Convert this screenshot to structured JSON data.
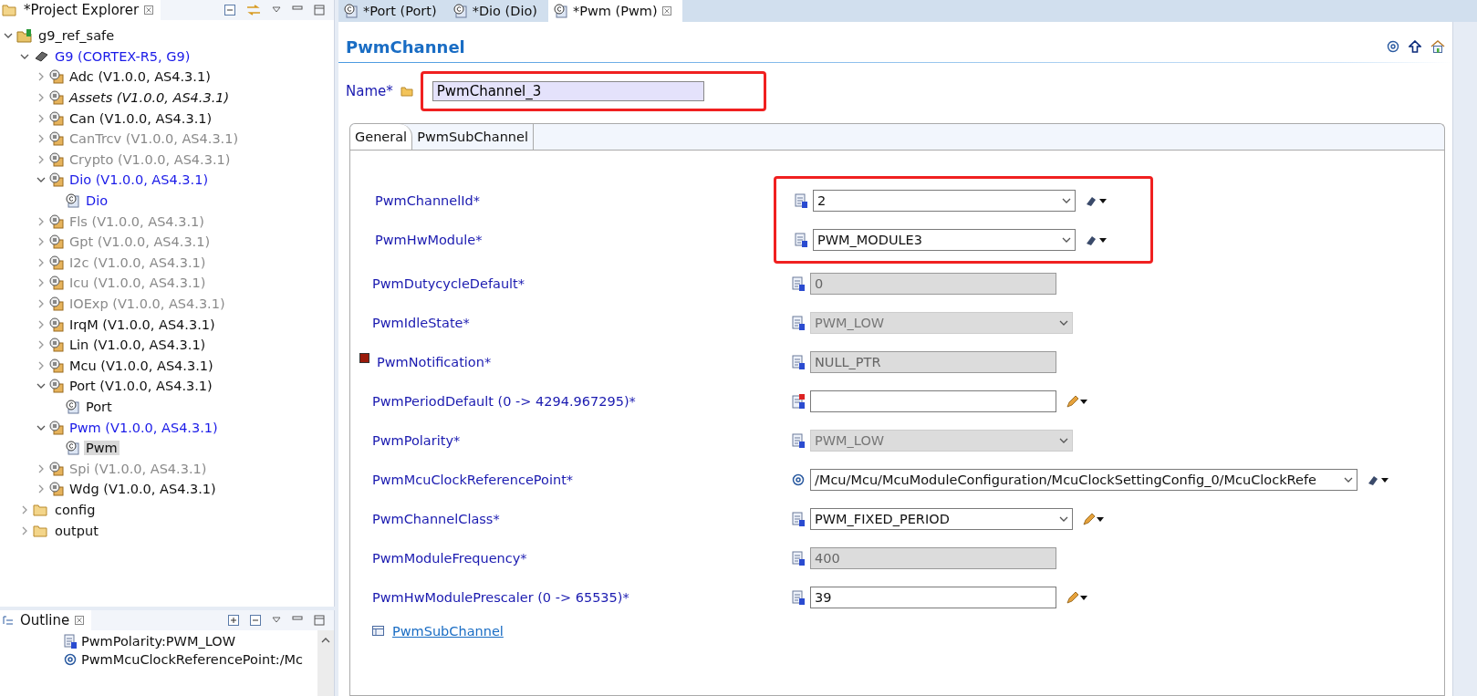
{
  "project_explorer": {
    "title": "*Project Explorer",
    "tree": [
      {
        "label": "g9_ref_safe",
        "kind": "project",
        "disabled": false,
        "modified": false,
        "emphasized": false,
        "expanded": true,
        "selected": false,
        "children": [
          {
            "label": "G9 (CORTEX-R5, G9)",
            "kind": "chip",
            "disabled": false,
            "modified": true,
            "emphasized": false,
            "expanded": true,
            "selected": false,
            "children": [
              {
                "label": "Adc (V1.0.0, AS4.3.1)",
                "kind": "module",
                "disabled": false,
                "modified": false,
                "emphasized": false,
                "expanded": false,
                "selected": false
              },
              {
                "label": "Assets (V1.0.0, AS4.3.1)",
                "kind": "module",
                "disabled": false,
                "modified": false,
                "emphasized": true,
                "expanded": false,
                "selected": false
              },
              {
                "label": "Can (V1.0.0, AS4.3.1)",
                "kind": "module",
                "disabled": false,
                "modified": false,
                "emphasized": false,
                "expanded": false,
                "selected": false
              },
              {
                "label": "CanTrcv (V1.0.0, AS4.3.1)",
                "kind": "module",
                "disabled": true,
                "modified": false,
                "emphasized": false,
                "expanded": false,
                "selected": false
              },
              {
                "label": "Crypto (V1.0.0, AS4.3.1)",
                "kind": "module",
                "disabled": true,
                "modified": false,
                "emphasized": false,
                "expanded": false,
                "selected": false
              },
              {
                "label": "Dio (V1.0.0, AS4.3.1)",
                "kind": "module",
                "disabled": false,
                "modified": true,
                "emphasized": false,
                "expanded": true,
                "selected": false,
                "children": [
                  {
                    "label": "Dio",
                    "kind": "config",
                    "disabled": false,
                    "modified": true,
                    "emphasized": false,
                    "selected": false
                  }
                ]
              },
              {
                "label": "Fls (V1.0.0, AS4.3.1)",
                "kind": "module",
                "disabled": true,
                "modified": false,
                "emphasized": false,
                "expanded": false,
                "selected": false
              },
              {
                "label": "Gpt (V1.0.0, AS4.3.1)",
                "kind": "module",
                "disabled": true,
                "modified": false,
                "emphasized": false,
                "expanded": false,
                "selected": false
              },
              {
                "label": "I2c (V1.0.0, AS4.3.1)",
                "kind": "module",
                "disabled": true,
                "modified": false,
                "emphasized": false,
                "expanded": false,
                "selected": false
              },
              {
                "label": "Icu (V1.0.0, AS4.3.1)",
                "kind": "module",
                "disabled": true,
                "modified": false,
                "emphasized": false,
                "expanded": false,
                "selected": false
              },
              {
                "label": "IOExp (V1.0.0, AS4.3.1)",
                "kind": "module",
                "disabled": true,
                "modified": false,
                "emphasized": false,
                "expanded": false,
                "selected": false
              },
              {
                "label": "IrqM (V1.0.0, AS4.3.1)",
                "kind": "module",
                "disabled": false,
                "modified": false,
                "emphasized": false,
                "expanded": false,
                "selected": false
              },
              {
                "label": "Lin (V1.0.0, AS4.3.1)",
                "kind": "module",
                "disabled": false,
                "modified": false,
                "emphasized": false,
                "expanded": false,
                "selected": false
              },
              {
                "label": "Mcu (V1.0.0, AS4.3.1)",
                "kind": "module",
                "disabled": false,
                "modified": false,
                "emphasized": false,
                "expanded": false,
                "selected": false
              },
              {
                "label": "Port (V1.0.0, AS4.3.1)",
                "kind": "module",
                "disabled": false,
                "modified": false,
                "emphasized": false,
                "expanded": true,
                "selected": false,
                "children": [
                  {
                    "label": "Port",
                    "kind": "config",
                    "disabled": false,
                    "modified": false,
                    "emphasized": false,
                    "selected": false
                  }
                ]
              },
              {
                "label": "Pwm (V1.0.0, AS4.3.1)",
                "kind": "module",
                "disabled": false,
                "modified": true,
                "emphasized": false,
                "expanded": true,
                "selected": false,
                "children": [
                  {
                    "label": "Pwm",
                    "kind": "config",
                    "disabled": false,
                    "modified": false,
                    "emphasized": false,
                    "selected": true
                  }
                ]
              },
              {
                "label": "Spi (V1.0.0, AS4.3.1)",
                "kind": "module",
                "disabled": true,
                "modified": false,
                "emphasized": false,
                "expanded": false,
                "selected": false
              },
              {
                "label": "Wdg (V1.0.0, AS4.3.1)",
                "kind": "module",
                "disabled": false,
                "modified": false,
                "emphasized": false,
                "expanded": false,
                "selected": false
              }
            ]
          },
          {
            "label": "config",
            "kind": "folder",
            "disabled": false,
            "modified": false,
            "emphasized": false,
            "expanded": false,
            "selected": false
          },
          {
            "label": "output",
            "kind": "folder",
            "disabled": false,
            "modified": false,
            "emphasized": false,
            "expanded": false,
            "selected": false
          }
        ]
      }
    ]
  },
  "outline": {
    "title": "Outline",
    "items": [
      {
        "label": "PwmPolarity:PWM_LOW",
        "kind": "parameter"
      },
      {
        "label": "PwmMcuClockReferencePoint:/Mc",
        "kind": "reference"
      }
    ]
  },
  "editor_tabs": [
    {
      "label": "*Port (Port)",
      "selected": false
    },
    {
      "label": "*Dio (Dio)",
      "selected": false
    },
    {
      "label": "*Pwm (Pwm)",
      "selected": true
    }
  ],
  "editor": {
    "title": "PwmChannel",
    "name_label": "Name*",
    "name_value": "PwmChannel_3",
    "name_highlighted": true,
    "tabs": [
      {
        "label": "General",
        "selected": true
      },
      {
        "label": "PwmSubChannel",
        "selected": false
      }
    ],
    "rows": [
      {
        "label": "PwmChannelId*",
        "kind": "dropdown",
        "value": "2",
        "disabled": false,
        "invalid": false,
        "wand_button": true,
        "pencil_button": false,
        "highlighted": true,
        "flagged": false
      },
      {
        "label": "PwmHwModule*",
        "kind": "dropdown",
        "value": "PWM_MODULE3",
        "disabled": false,
        "invalid": false,
        "wand_button": true,
        "pencil_button": false,
        "highlighted": true,
        "flagged": false
      },
      {
        "label": "PwmDutycycleDefault*",
        "kind": "field",
        "value": "0",
        "disabled": true,
        "invalid": false,
        "wand_button": false,
        "pencil_button": false,
        "highlighted": false,
        "flagged": false
      },
      {
        "label": "PwmIdleState*",
        "kind": "dropdown",
        "value": "PWM_LOW",
        "disabled": true,
        "invalid": false,
        "wand_button": false,
        "pencil_button": false,
        "highlighted": false,
        "flagged": false
      },
      {
        "label": "PwmNotification*",
        "kind": "field",
        "value": "NULL_PTR",
        "disabled": true,
        "invalid": false,
        "wand_button": false,
        "pencil_button": false,
        "highlighted": false,
        "flagged": true
      },
      {
        "label": "PwmPeriodDefault (0 -> 4294.967295)*",
        "kind": "field",
        "disabled": false,
        "invalid": true,
        "wand_button": false,
        "pencil_button": true,
        "highlighted": false,
        "flagged": false
      },
      {
        "label": "PwmPolarity*",
        "kind": "dropdown",
        "value": "PWM_LOW",
        "disabled": true,
        "invalid": false,
        "wand_button": false,
        "pencil_button": false,
        "highlighted": false,
        "flagged": false
      },
      {
        "label": "PwmMcuClockReferencePoint*",
        "kind": "reference",
        "value": "/Mcu/Mcu/McuModuleConfiguration/McuClockSettingConfig_0/McuClockRefe",
        "disabled": false,
        "invalid": false,
        "wand_button": true,
        "pencil_button": false,
        "highlighted": false,
        "flagged": false
      },
      {
        "label": "PwmChannelClass*",
        "kind": "dropdown",
        "value": "PWM_FIXED_PERIOD",
        "disabled": false,
        "invalid": false,
        "wand_button": false,
        "pencil_button": true,
        "highlighted": false,
        "flagged": false
      },
      {
        "label": "PwmModuleFrequency*",
        "kind": "field",
        "value": "400",
        "disabled": true,
        "invalid": false,
        "wand_button": false,
        "pencil_button": false,
        "highlighted": false,
        "flagged": false
      },
      {
        "label": "PwmHwModulePrescaler (0 -> 65535)*",
        "kind": "field",
        "value": "39",
        "disabled": false,
        "invalid": false,
        "wand_button": false,
        "pencil_button": true,
        "highlighted": false,
        "flagged": false
      }
    ],
    "link": "PwmSubChannel"
  }
}
